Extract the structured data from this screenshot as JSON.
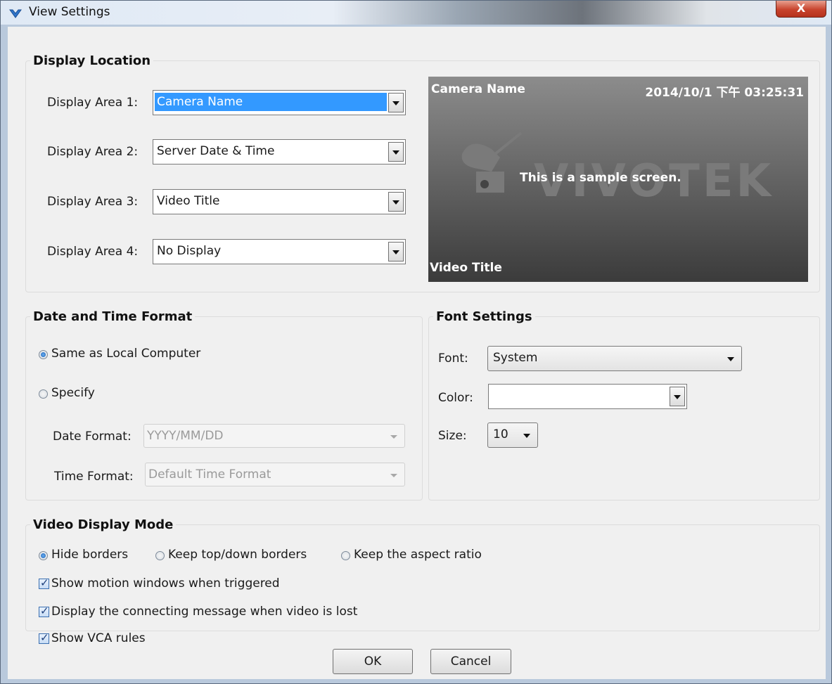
{
  "window": {
    "title": "View Settings",
    "close_label": "X"
  },
  "display_location": {
    "title": "Display Location",
    "areas": [
      {
        "label": "Display Area 1:",
        "value": "Camera Name"
      },
      {
        "label": "Display Area 2:",
        "value": "Server Date & Time"
      },
      {
        "label": "Display Area 3:",
        "value": "Video Title"
      },
      {
        "label": "Display Area 4:",
        "value": "No Display"
      }
    ],
    "preview": {
      "camera_name": "Camera Name",
      "datetime": "2014/10/1 下午 03:25:31",
      "logo": "VIVOTEK",
      "sample_text": "This is a sample screen.",
      "video_title": "Video Title"
    }
  },
  "date_time_format": {
    "title": "Date and Time Format",
    "option_local": "Same as Local Computer",
    "option_specify": "Specify",
    "date_format_label": "Date Format:",
    "date_format_value": "YYYY/MM/DD",
    "time_format_label": "Time Format:",
    "time_format_value": "Default Time Format"
  },
  "font_settings": {
    "title": "Font Settings",
    "font_label": "Font:",
    "font_value": "System",
    "color_label": "Color:",
    "color_value": "",
    "size_label": "Size:",
    "size_value": "10"
  },
  "video_display_mode": {
    "title": "Video Display Mode",
    "modes": [
      "Hide borders",
      "Keep top/down borders",
      "Keep the aspect ratio"
    ],
    "checkboxes": [
      "Show motion windows when triggered",
      "Display the connecting message when video is lost",
      "Show VCA rules"
    ]
  },
  "buttons": {
    "ok": "OK",
    "cancel": "Cancel"
  }
}
